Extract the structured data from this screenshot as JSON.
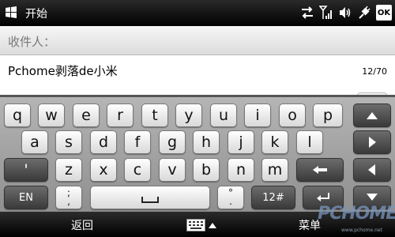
{
  "status_bar": {
    "title": "开始",
    "ok_label": "OK"
  },
  "compose": {
    "recipient_label": "收件人：",
    "message_text": "Pchome剥落de小米",
    "char_count": "12/70"
  },
  "keyboard": {
    "row1": [
      "q",
      "w",
      "e",
      "r",
      "t",
      "y",
      "u",
      "i",
      "o",
      "p"
    ],
    "row2": [
      "a",
      "s",
      "d",
      "f",
      "g",
      "h",
      "j",
      "k",
      "l"
    ],
    "row3_left": "'",
    "row3": [
      "z",
      "x",
      "c",
      "v",
      "b",
      "n",
      "m"
    ],
    "row4": {
      "lang": "EN",
      "semicolon": ";",
      "comma": ",",
      "degree": "°",
      "period": ".",
      "symbols": "12#"
    }
  },
  "softkeys": {
    "left": "返回",
    "right": "菜单"
  },
  "watermark": {
    "brand": "PCHOME",
    "url": "www.pchome.net"
  }
}
